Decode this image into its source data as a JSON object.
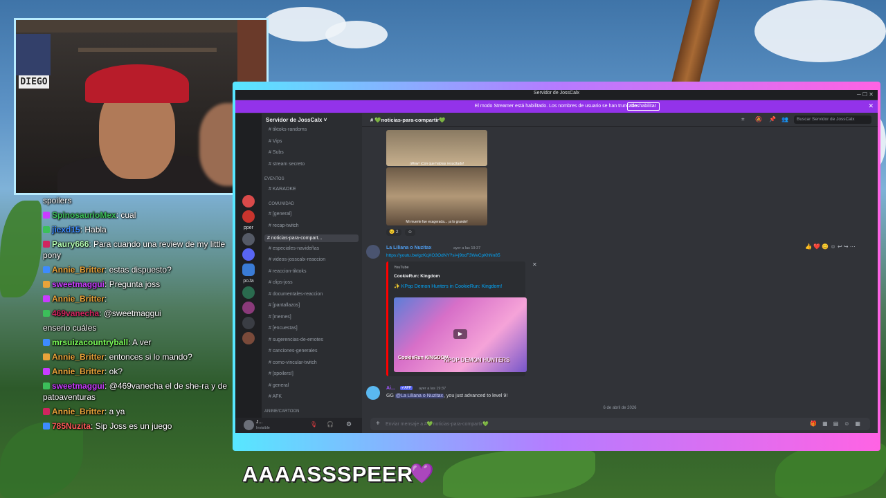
{
  "webcam": {
    "sign_text": "DIEGO"
  },
  "chat": {
    "messages": [
      {
        "user": "",
        "text": "spoilers",
        "user_color": "#ffffff"
      },
      {
        "user": "SpinosaurioMex",
        "text": ": cual",
        "user_color": "#3cbf5a"
      },
      {
        "user": "jiexd15",
        "text": ": Habla",
        "user_color": "#3d8bff"
      },
      {
        "user": "Paury666",
        "text": ": Para cuando una review de my little pony",
        "user_color": "#b4ffb4"
      },
      {
        "user": "Annie_Britter",
        "text": ": estas dispuesto?",
        "user_color": "#e8a33a"
      },
      {
        "user": "sweetmaggui",
        "text": ": Pregunta joss",
        "user_color": "#c93cff"
      },
      {
        "user": "Annie_Britter",
        "text": ":",
        "user_color": "#e8a33a"
      },
      {
        "user": "469vanecha",
        "text": ": @sweetmaggui",
        "user_color": "#d0255f"
      },
      {
        "user": "",
        "text": "enserio cuáles",
        "user_color": "#ffffff"
      },
      {
        "user": "mrsuizacountryball",
        "text": ": A ver",
        "user_color": "#7cff5a"
      },
      {
        "user": "Annie_Britter",
        "text": ": entonces si lo mando?",
        "user_color": "#e8a33a"
      },
      {
        "user": "Annie_Britter",
        "text": ": ok?",
        "user_color": "#e8a33a"
      },
      {
        "user": "sweetmaggui",
        "text": ": @469vanecha el de she-ra y de patoaventuras",
        "user_color": "#c93cff"
      },
      {
        "user": "Annie_Britter",
        "text": ": a ya",
        "user_color": "#e8a33a"
      },
      {
        "user": "785Nuzita",
        "text": ": Sip Joss es un juego",
        "user_color": "#ff5a5a"
      }
    ]
  },
  "discord": {
    "window_title": "Servidor de JossCalx",
    "streamer_banner": "El modo Streamer está habilitado. Los nombres de usuario se han truncado.",
    "disable_button": "Deshabilitar",
    "server_name": "Servidor de JossCalx",
    "server_labels": [
      "pper",
      "poJa"
    ],
    "channels": {
      "top": [
        "tiktoks-randoms",
        "Vips",
        "Subs",
        "stream secreto"
      ],
      "events_category": "EVENTOS",
      "events": [
        "KARAOKE"
      ],
      "community_category": "Comunidad",
      "community": [
        "[general]",
        "recap-twitch",
        "noticias-para-compart...",
        "especiales-navideñas",
        "videos-josscalx-reaccion",
        "reaccion-tiktoks",
        "clips-joss",
        "documentales-reaccion",
        "[pantallazos]",
        "[memes]",
        "[encuestas]",
        "sugerencias-de-emotes",
        "canciones-generales",
        "como-vincular-twitch",
        "[spoilers!]",
        "general",
        "AFK"
      ],
      "anime_category": "ANIME/CARTOON"
    },
    "user_panel": {
      "name": "J...",
      "status": "Invisible"
    },
    "channel_title": "noticias-para-compartir",
    "search_placeholder": "Buscar Servidor de JossCalx",
    "meme_subtitle_1": "¡Wow! ¡Con que habías resucitado!",
    "meme_subtitle_2": "Mi muerte fue exagerada... ¡a lo grande!",
    "reaction_count": "2",
    "message2": {
      "author": "La Liliana o Nuzitax",
      "timestamp": "ayer a las 19:37",
      "link": "https://youtu.be/gzKqXO3OdNY?si=j9bcF3WvCpKhNn85",
      "embed_provider": "YouTube",
      "embed_author": "CookieRun: Kingdom",
      "embed_title": "KPop Demon Hunters in CookieRun: Kingdom!",
      "thumb_text_1": "CookieRun KINGDOM",
      "thumb_text_2": "KPOP DEMON HUNTERS"
    },
    "message3": {
      "author": "Ai...",
      "app_badge": "APP",
      "timestamp": "ayer a las 19:37",
      "prefix": "GG ",
      "mention": "@La Liliana o Nuzitax",
      "suffix": ", you just advanced to level 9!"
    },
    "day_separator": "6 de abril de 2026",
    "composer_placeholder": "Enviar mensaje a #💚noticias-para-compartir💚"
  },
  "caption": {
    "text": "AAAASSSPEER",
    "heart": "💜"
  },
  "colors": {
    "frame_gradient": [
      "#57e7ff",
      "#b67bff",
      "#ff63e4"
    ],
    "streamer_bar": "#9333ea",
    "discord_bg": "#313338"
  }
}
